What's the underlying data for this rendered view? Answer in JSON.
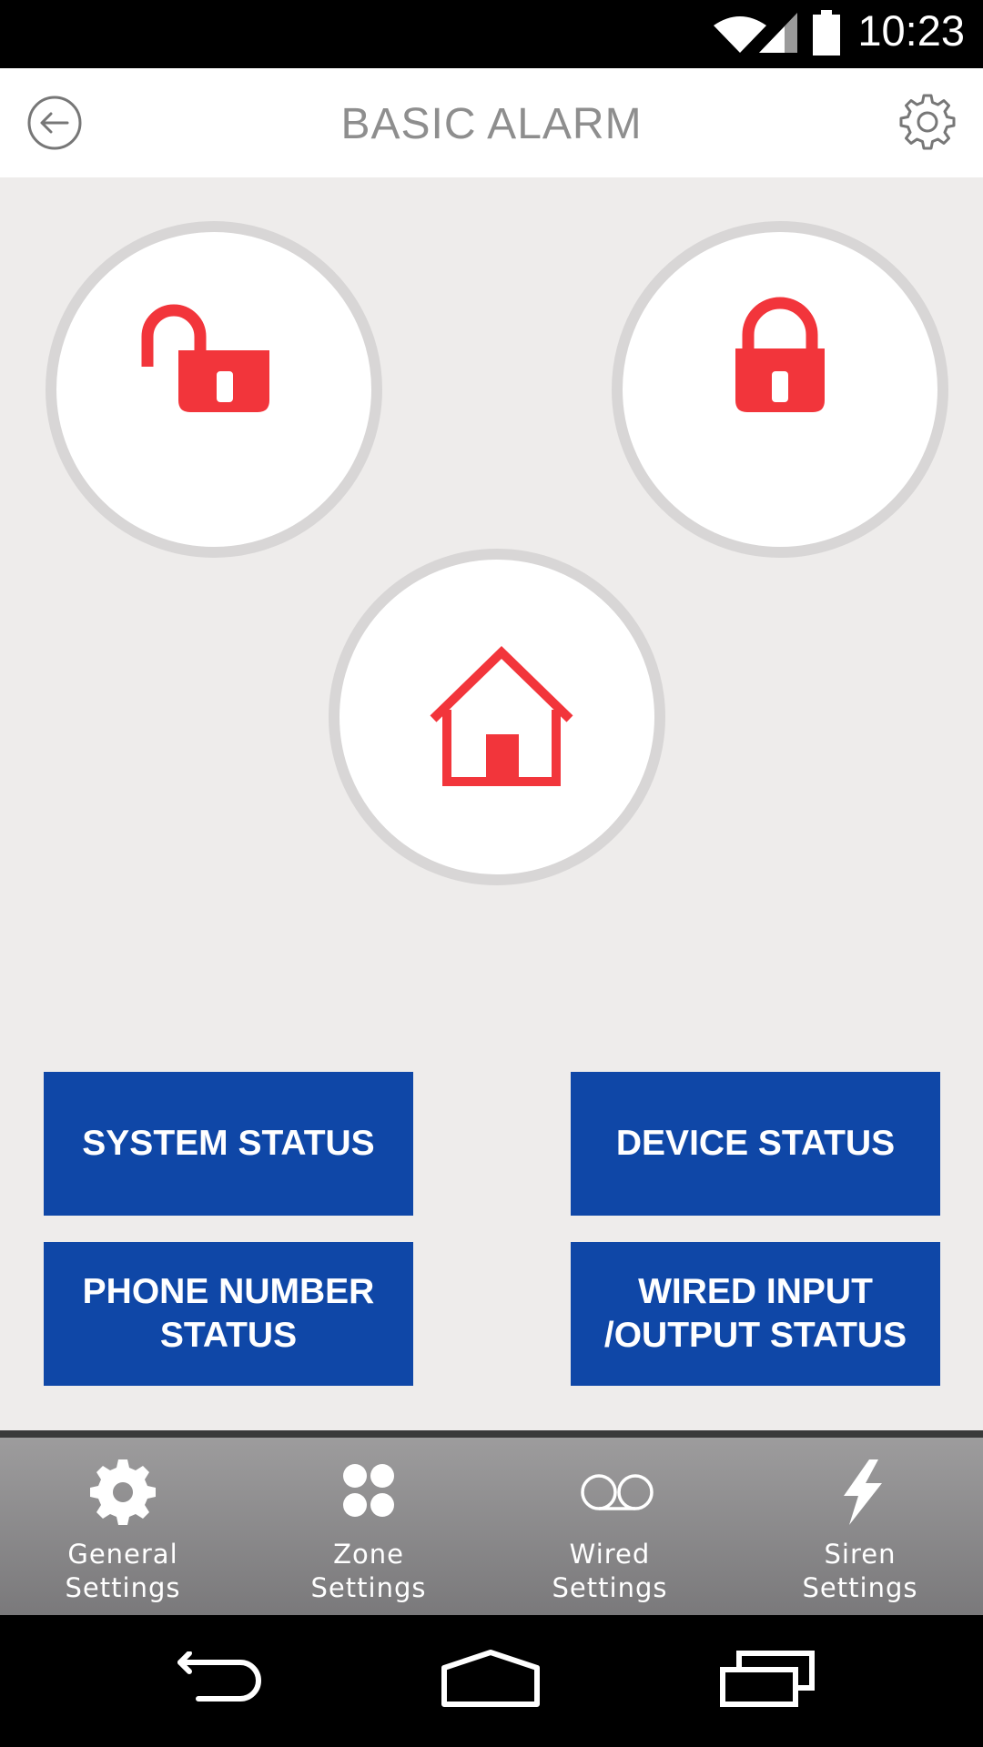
{
  "status_bar": {
    "time": "10:23",
    "icons": [
      "wifi-icon",
      "signal-icon",
      "battery-icon"
    ]
  },
  "header": {
    "title": "BASIC ALARM",
    "back_icon": "back-arrow-icon",
    "settings_icon": "gear-icon"
  },
  "modes": [
    {
      "name": "disarm",
      "icon": "unlocked-padlock-icon"
    },
    {
      "name": "arm",
      "icon": "locked-padlock-icon"
    },
    {
      "name": "home",
      "icon": "house-icon"
    }
  ],
  "status_buttons": {
    "system": "SYSTEM STATUS",
    "device": "DEVICE STATUS",
    "phone": "PHONE NUMBER\nSTATUS",
    "wired": "WIRED INPUT\n/OUTPUT STATUS"
  },
  "bottom_nav": [
    {
      "label": "General\nSettings",
      "icon": "gear-icon"
    },
    {
      "label": "Zone\nSettings",
      "icon": "four-dots-icon"
    },
    {
      "label": "Wired\nSettings",
      "icon": "double-circle-icon"
    },
    {
      "label": "Siren\nSettings",
      "icon": "lightning-icon"
    }
  ],
  "colors": {
    "accent_red": "#f2353b",
    "button_blue": "#0f47a7",
    "background": "#eeeceb"
  }
}
